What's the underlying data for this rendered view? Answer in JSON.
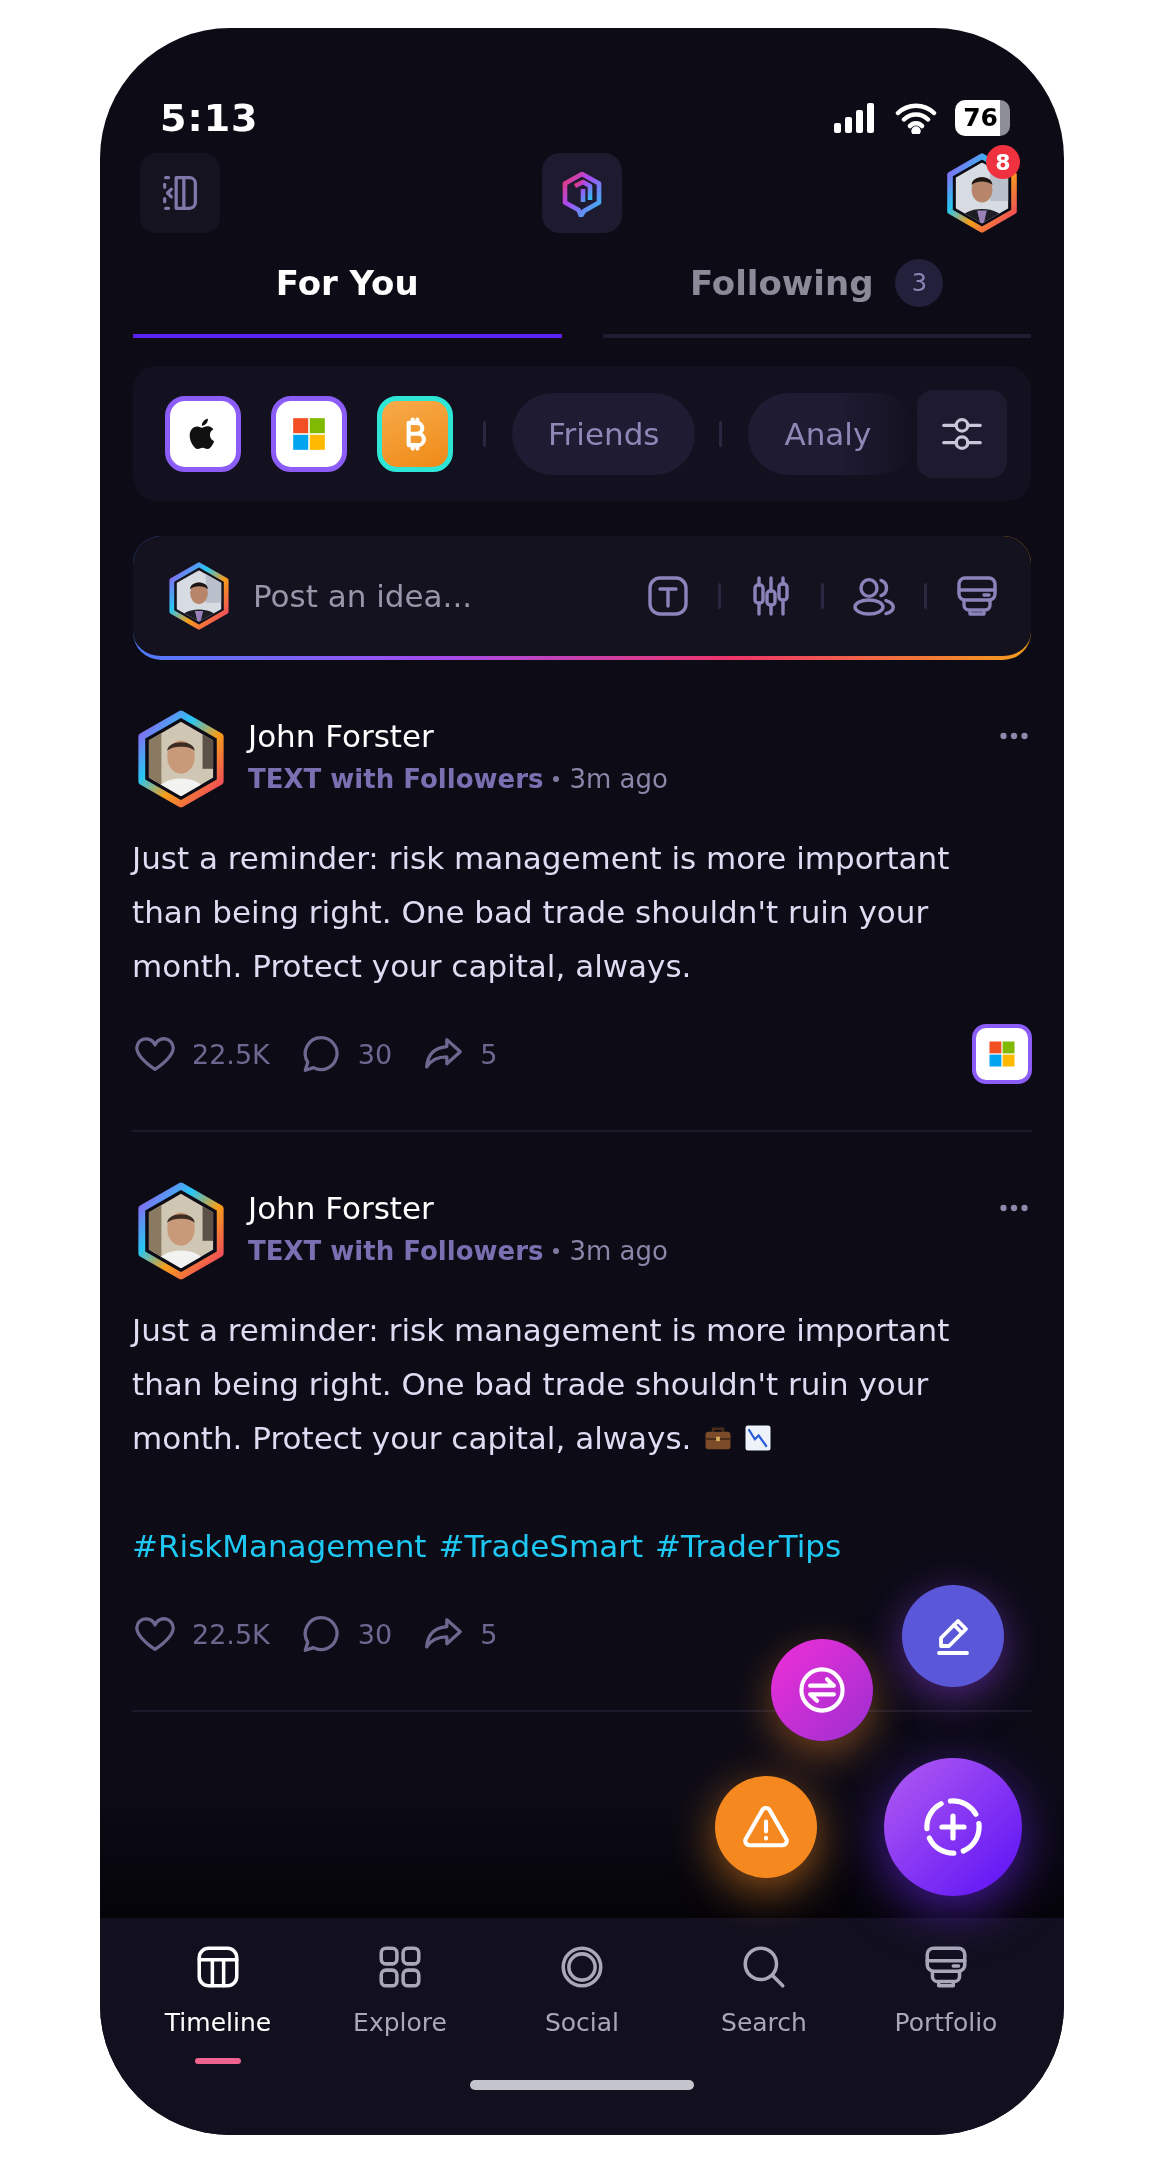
{
  "status_bar": {
    "time": "5:13",
    "battery": "76"
  },
  "header": {
    "notifications": "8"
  },
  "tabs": [
    {
      "label": "For You",
      "selected": true
    },
    {
      "label": "Following",
      "selected": false,
      "count": "3"
    }
  ],
  "filters": {
    "assets": [
      {
        "kind": "apple",
        "color": "#8b5cf6"
      },
      {
        "kind": "microsoft",
        "color": "#8b5cf6"
      },
      {
        "kind": "bitcoin",
        "color": "#2ee6d6"
      }
    ],
    "chips": [
      {
        "label": "Friends"
      },
      {
        "label": "Analy"
      }
    ]
  },
  "composer": {
    "placeholder": "Post an idea..."
  },
  "posts": [
    {
      "author": "John Forster",
      "audience": "TEXT with Followers",
      "time": "3m ago",
      "body": "Just a reminder: risk management is more important than being right. One bad trade shouldn't ruin your month. Protect your capital, always.",
      "likes": "22.5K",
      "comments": "30",
      "shares": "5",
      "asset": {
        "kind": "microsoft"
      }
    },
    {
      "author": "John Forster",
      "audience": "TEXT with Followers",
      "time": "3m ago",
      "body": "Just a reminder: risk management is more important than being right. One bad trade shouldn't ruin your month. Protect your capital, always.",
      "body_icons": [
        {
          "kind": "briefcase"
        },
        {
          "kind": "chart-down"
        }
      ],
      "hashtags": [
        "#RiskManagement",
        "#TradeSmart",
        "#TraderTips"
      ],
      "likes": "22.5K",
      "comments": "30",
      "shares": "5"
    }
  ],
  "nav": [
    {
      "label": "Timeline",
      "selected": true
    },
    {
      "label": "Explore",
      "selected": false
    },
    {
      "label": "Social",
      "selected": false
    },
    {
      "label": "Search",
      "selected": false
    },
    {
      "label": "Portfolio",
      "selected": false
    }
  ]
}
